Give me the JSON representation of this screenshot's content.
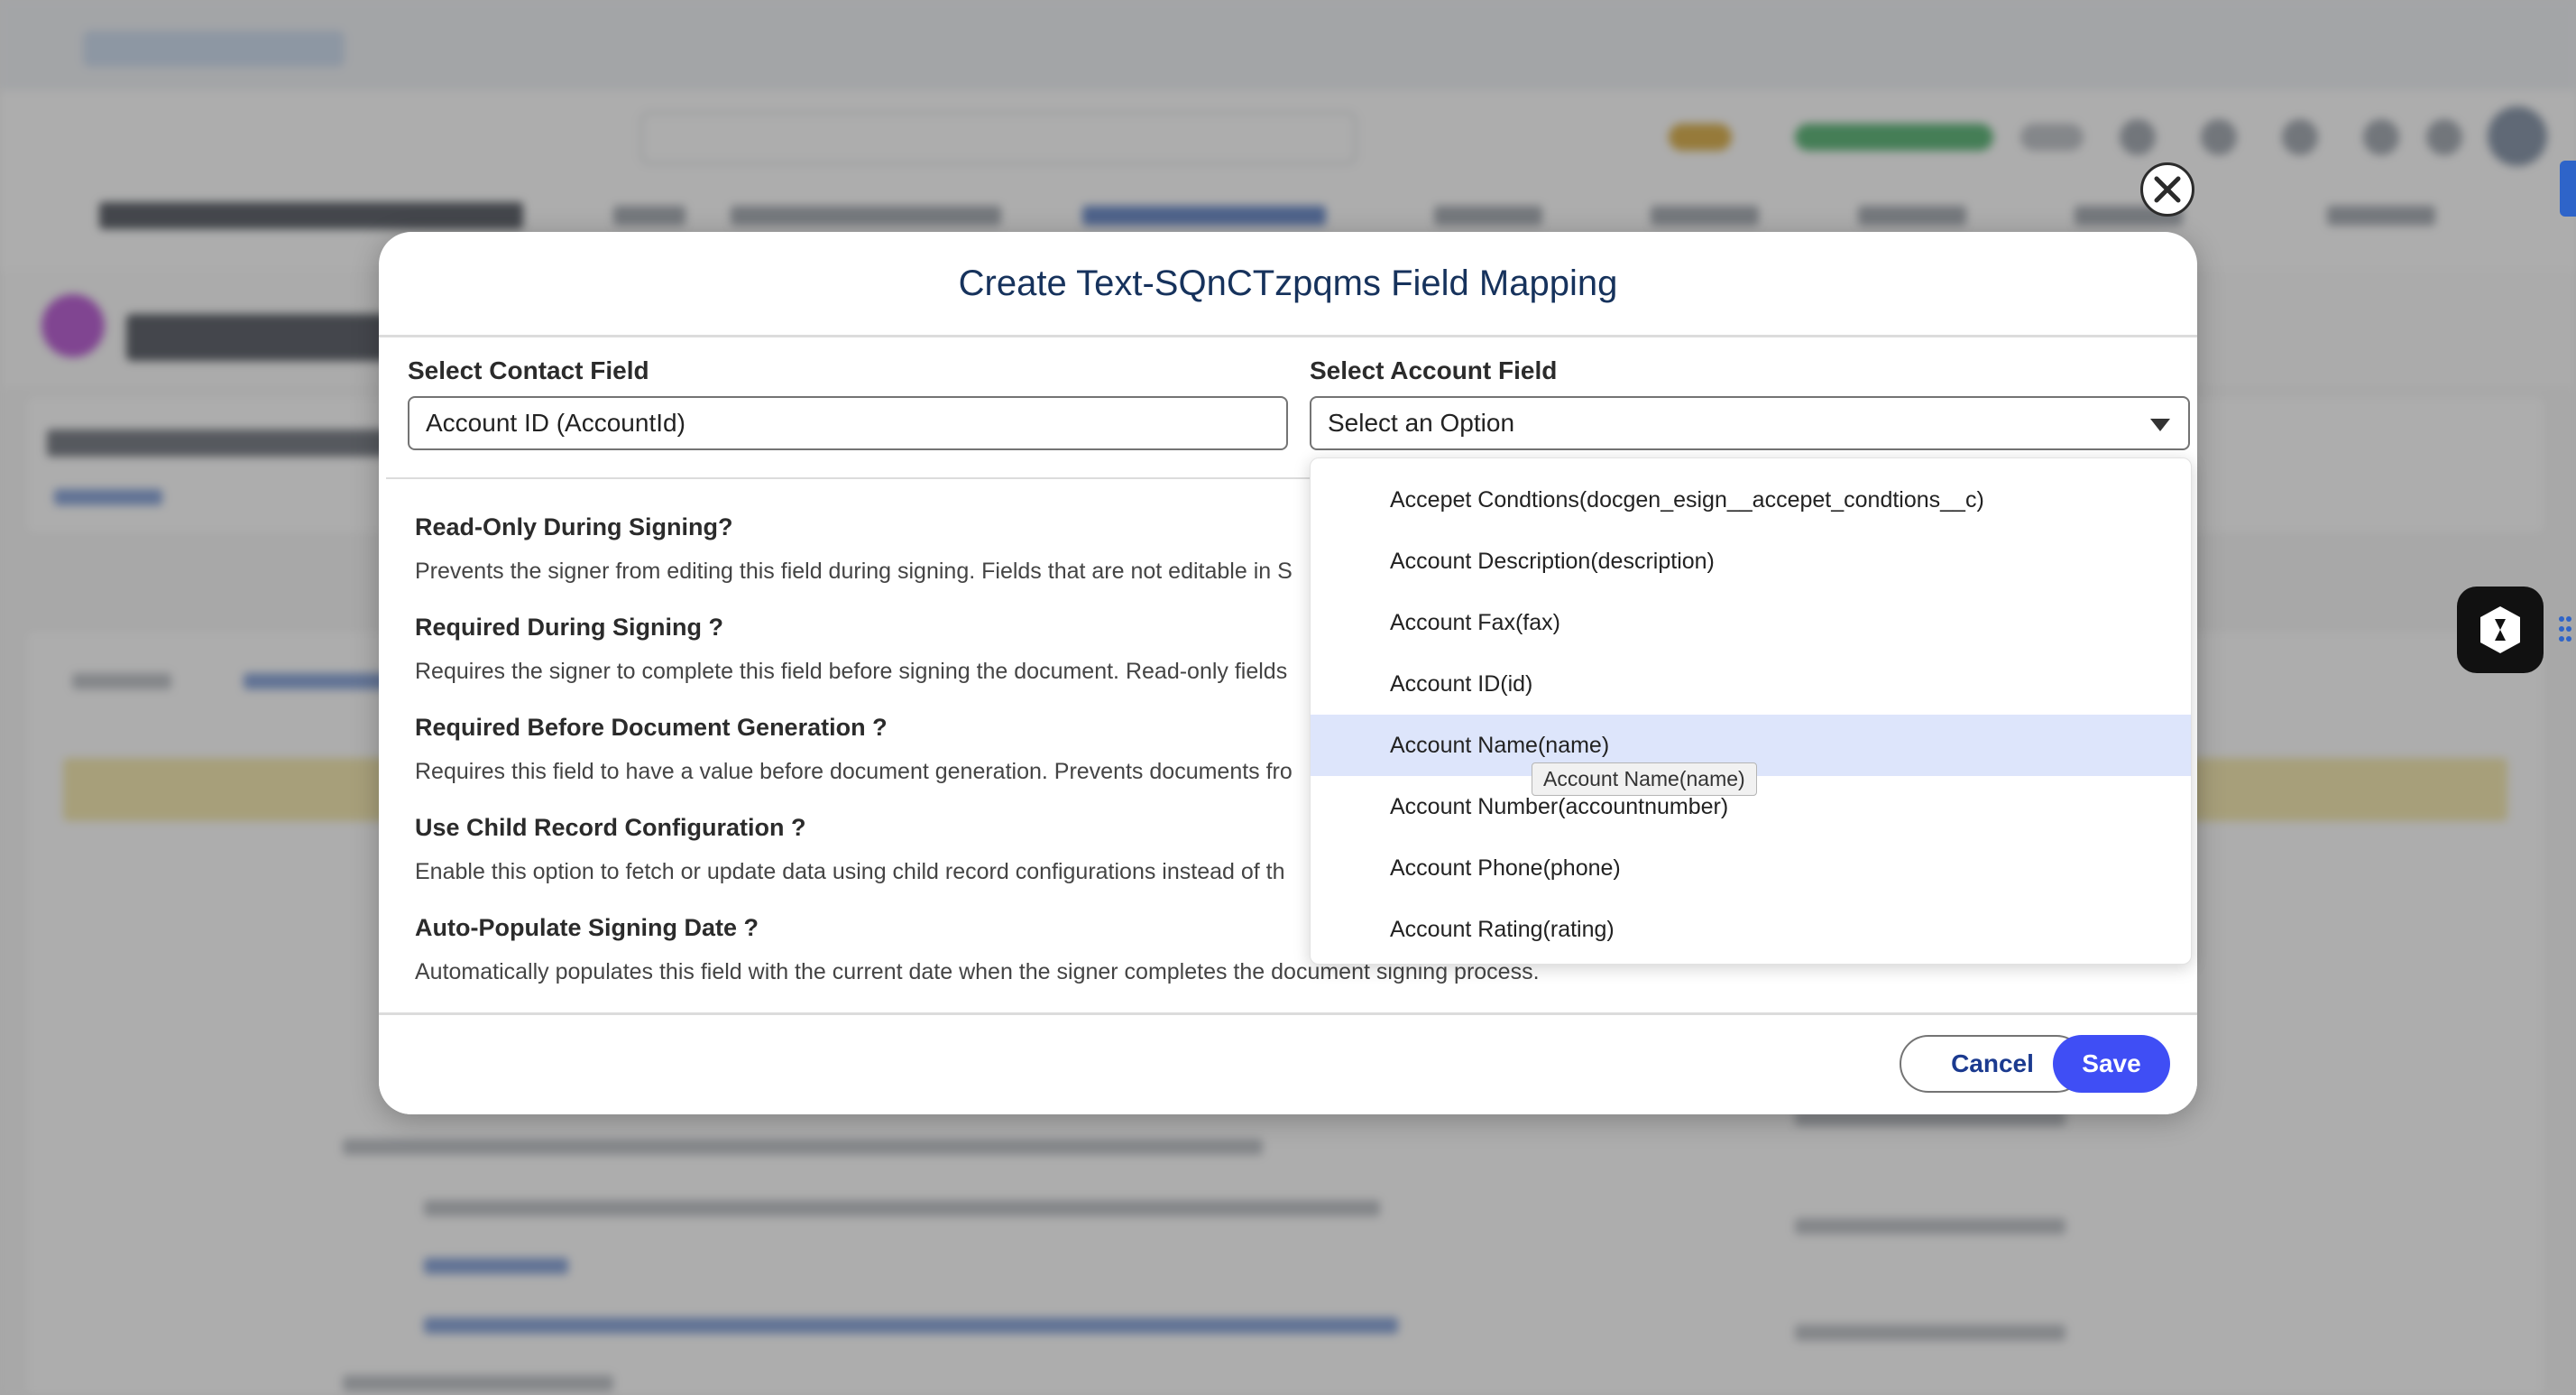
{
  "modal": {
    "title": "Create Text-SQnCTzpqms Field Mapping",
    "contact_field": {
      "label": "Select Contact Field",
      "value": "Account ID (AccountId)"
    },
    "account_field": {
      "label": "Select Account Field",
      "value": "Select an Option"
    },
    "options": [
      {
        "title": "Read-Only During Signing?",
        "description": "Prevents the signer from editing this field during signing. Fields that are not editable in S"
      },
      {
        "title": "Required During Signing ?",
        "description": "Requires the signer to complete this field before signing the document. Read-only fields"
      },
      {
        "title": "Required Before Document Generation ?",
        "description": "Requires this field to have a value before document generation. Prevents documents fro"
      },
      {
        "title": "Use Child Record Configuration ?",
        "description": "Enable this option to fetch or update data using child record configurations instead of th"
      },
      {
        "title": "Auto-Populate Signing Date ?",
        "description": "Automatically populates this field with the current date when the signer completes the document signing process."
      }
    ],
    "cancel_label": "Cancel",
    "save_label": "Save"
  },
  "dropdown": {
    "items": [
      "Accepet Condtions(docgen_esign__accepet_condtions__c)",
      "Account Description(description)",
      "Account Fax(fax)",
      "Account ID(id)",
      "Account Name(name)",
      "Account Number(accountnumber)",
      "Account Phone(phone)",
      "Account Rating(rating)"
    ],
    "highlighted_index": 4,
    "tooltip": "Account Name(name)"
  },
  "colors": {
    "title": "#16325c",
    "save_button": "#3f4ef5",
    "highlight": "#dde5fb"
  },
  "icons": [
    "close-icon",
    "chevron-down-icon",
    "brand-widget-icon",
    "drag-handle-icon"
  ]
}
